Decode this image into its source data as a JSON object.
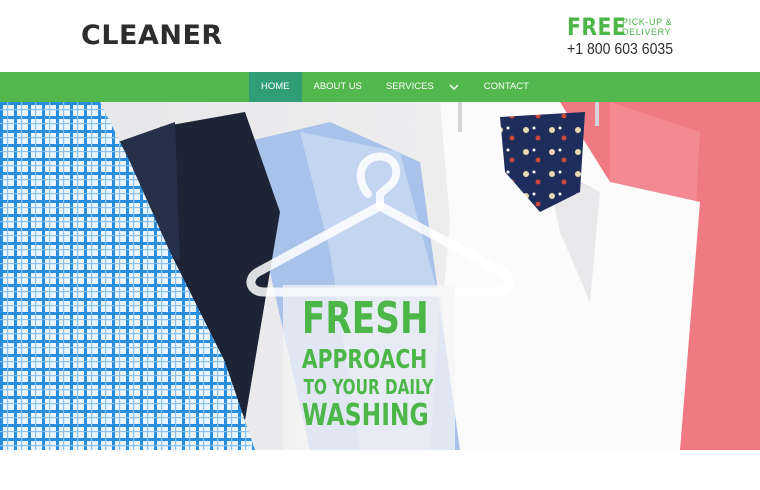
{
  "header": {
    "logo": "CLEANER",
    "promo": {
      "free": "FREE",
      "line1": "PICK-UP &",
      "line2": "DELIVERY",
      "phone": "+1 800 603 6035"
    }
  },
  "nav": {
    "items": [
      {
        "label": "HOME",
        "active": true
      },
      {
        "label": "ABOUT US",
        "active": false
      },
      {
        "label": "SERVICES",
        "active": false,
        "has_dropdown": true
      },
      {
        "label": "CONTACT",
        "active": false
      }
    ]
  },
  "hero": {
    "line1": "FRESH",
    "line2": "APPROACH",
    "line3": "TO YOUR DAILY",
    "line4": "WASHING"
  },
  "colors": {
    "accent": "#4cb748",
    "nav_bg": "#52b74c",
    "nav_active": "#2f9e77",
    "text_dark": "#2d2d2d"
  },
  "icons": {
    "dropdown": "chevron-down-icon",
    "hanger": "hanger-icon"
  }
}
